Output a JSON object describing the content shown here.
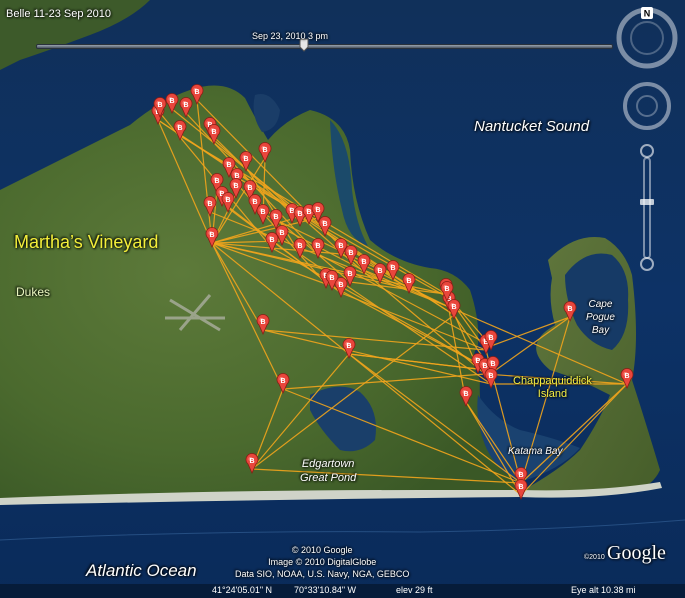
{
  "tour_title": "Belle 11-23 Sep 2010",
  "time_slider": {
    "current_time": "Sep 23, 2010   3 pm"
  },
  "navigation": {
    "north_label": "N"
  },
  "places": {
    "marthas_vineyard": "Martha’s Vineyard",
    "dukes": "Dukes",
    "nantucket_sound": "Nantucket Sound",
    "cape_pogue_bay_line1": "Cape",
    "cape_pogue_bay_line2": "Pogue",
    "cape_pogue_bay_line3": "Bay",
    "chappaquiddick_line1": "Chappaquiddick",
    "chappaquiddick_line2": "Island",
    "katama_bay": "Katama Bay",
    "edgartown_line1": "Edgartown",
    "edgartown_line2": "Great Pond",
    "atlantic_ocean": "Atlantic Ocean"
  },
  "marker_letter": "B",
  "track_color": "#f2a51c",
  "marker_color": "#e8463c",
  "attribution": {
    "line1": "© 2010 Google",
    "line2": "Image © 2010 DigitalGlobe",
    "line3": "Data SIO, NOAA, U.S. Navy, NGA, GEBCO"
  },
  "google_logo": "Google",
  "google_logo_year": "©2010",
  "status_bar": {
    "latitude": "41°24'05.01\" N",
    "longitude": "70°33'10.84\" W",
    "elevation": "elev   29 ft",
    "eye_altitude": "Eye alt   10.38 mi"
  }
}
